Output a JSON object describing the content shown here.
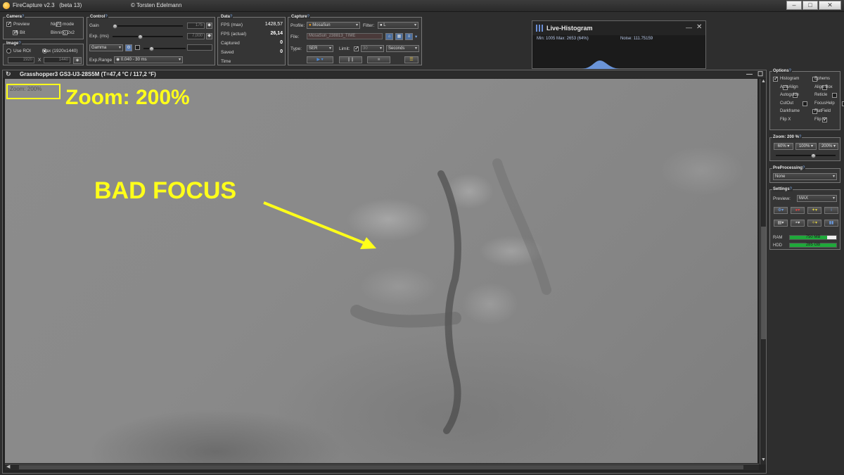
{
  "window": {
    "app_title": "FireCapture v2.3   (beta 13)",
    "author": "© Torsten Edelmann",
    "controls": [
      "–",
      "□",
      "✕"
    ]
  },
  "camera": {
    "title": "Camera",
    "preview": "Preview",
    "bit16": "16 Bit",
    "night_mode": "Night mode",
    "binning": "Binning 2x2"
  },
  "image": {
    "title": "Image",
    "use_roi": "Use ROI",
    "max": "Max (1920x1440)",
    "width": "1920",
    "x": "X",
    "height": "1440"
  },
  "control": {
    "title": "Control",
    "gain_label": "Gain",
    "gain_value": "175",
    "exp_label": "Exp. (ms)",
    "exp_value": "7,000",
    "gamma": "Gamma",
    "exp_range_label": "Exp.Range",
    "exp_range_value": "0.040 - 30 ms"
  },
  "data": {
    "title": "Data",
    "rows": [
      {
        "label": "FPS (max)",
        "value": "1428,57"
      },
      {
        "label": "FPS (actual)",
        "value": "26,14"
      },
      {
        "label": "Captured",
        "value": "0"
      },
      {
        "label": "Saved",
        "value": "0"
      },
      {
        "label": "Time",
        "value": ""
      }
    ]
  },
  "capture": {
    "title": "Capture",
    "profile_label": "Profile:",
    "profile_value": "MosaSun",
    "filter_label": "Filter:",
    "filter_value": "L",
    "file_label": "File:",
    "file_value": "MosaSun_238813_TIME",
    "type_label": "Type:",
    "type_value": "SER",
    "limit_label": "Limit:",
    "limit_value": "30",
    "limit_unit": "Seconds"
  },
  "histogram": {
    "title": "Live-Histogram",
    "stats": "Min: 1005 Max: 2653  (64%)",
    "noise": "Noise: 111.75159"
  },
  "viewer": {
    "title": "Grasshopper3 GS3-U3-28S5M  (T=47,4 °C / 117,2 °F)",
    "zoom_small": "Zoom: 200%",
    "zoom_big": "Zoom: 200%",
    "annotation": "BAD FOCUS"
  },
  "options": {
    "title": "Options",
    "items": [
      {
        "label": "Histogram",
        "checked": true
      },
      {
        "label": "Ephems",
        "checked": false
      },
      {
        "label": "AutoAlign",
        "checked": false
      },
      {
        "label": "Align-Box",
        "checked": false
      },
      {
        "label": "Autoguide",
        "checked": false
      },
      {
        "label": "Reticle",
        "checked": false
      },
      {
        "label": "CutOut",
        "checked": false
      },
      {
        "label": "FocusHelp",
        "checked": false
      },
      {
        "label": "Darkframe",
        "checked": false
      },
      {
        "label": "FlatField",
        "checked": false
      },
      {
        "label": "Flip X",
        "checked": true
      },
      {
        "label": "Flip Y",
        "checked": false
      }
    ]
  },
  "zoom": {
    "title": "Zoom: 200 %",
    "buttons": [
      "60%",
      "100%",
      "200%"
    ]
  },
  "preprocessing": {
    "title": "PreProcessing",
    "value": "None"
  },
  "settings": {
    "title": "Settings",
    "preview_label": "Preview:",
    "preview_value": "MAX",
    "ram_label": "RAM",
    "ram_value": "750 MB",
    "hdd_label": "HDD",
    "hdd_value": "285 GB"
  },
  "colors": {
    "annotation": "#ffff1a",
    "bar_green": "#1fa83a"
  }
}
